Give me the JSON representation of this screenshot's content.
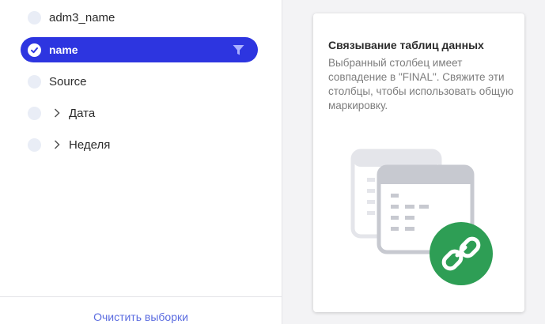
{
  "fields": [
    {
      "label": "adm3_name",
      "selected": false,
      "expandable": false
    },
    {
      "label": "name",
      "selected": true,
      "expandable": false
    },
    {
      "label": "Source",
      "selected": false,
      "expandable": false
    },
    {
      "label": "Дата",
      "selected": false,
      "expandable": true
    },
    {
      "label": "Неделя",
      "selected": false,
      "expandable": true
    }
  ],
  "footer": {
    "clear_label": "Очистить выборки"
  },
  "info_card": {
    "title": "Связывание таблиц данных",
    "body": "Выбранный столбец имеет совпадение в \"FINAL\". Свяжите эти столбцы, чтобы использовать общую маркировку."
  },
  "colors": {
    "accent": "#2d35e0",
    "link": "#5b6ce0",
    "link_badge": "#2e9e55"
  },
  "icons": [
    "check-circle-icon",
    "filter-icon",
    "chevron-right-icon",
    "table-link-illustration",
    "chain-link-icon"
  ]
}
